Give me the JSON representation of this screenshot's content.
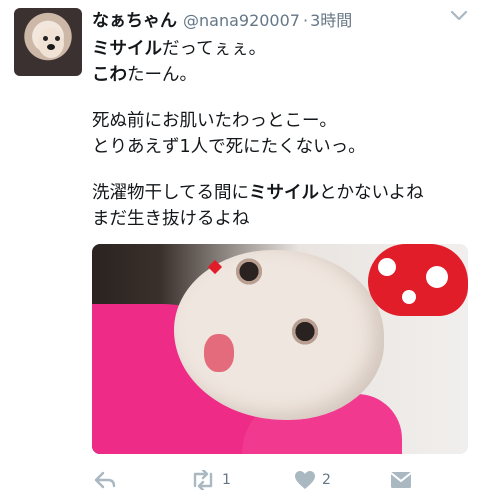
{
  "tweet": {
    "author_name": "なぁちゃん",
    "handle": "@nana920007",
    "separator": "·",
    "time": "3時間",
    "lines": [
      [
        {
          "text": "ミサイル",
          "bold": true
        },
        {
          "text": "だってぇぇ。",
          "bold": false
        }
      ],
      [
        {
          "text": "こわ",
          "bold": true
        },
        {
          "text": "たーん。",
          "bold": false
        }
      ],
      [],
      [
        {
          "text": "死ぬ前にお肌いたわっとこー。",
          "bold": false
        }
      ],
      [
        {
          "text": "とりあえず1人で死にたくないっ。",
          "bold": false
        }
      ],
      [],
      [
        {
          "text": "洗濯物干してる間に",
          "bold": false
        },
        {
          "text": "ミサイル",
          "bold": true
        },
        {
          "text": "とかないよね",
          "bold": false
        }
      ],
      [
        {
          "text": "まだ生き抜けるよね",
          "bold": false
        }
      ]
    ]
  },
  "actions": {
    "reply": {
      "icon": "reply-icon"
    },
    "retweet": {
      "icon": "retweet-icon",
      "count": "1"
    },
    "like": {
      "icon": "heart-icon",
      "count": "2"
    },
    "dm": {
      "icon": "envelope-icon"
    }
  },
  "colors": {
    "muted": "#657786",
    "text": "#14171a",
    "accent_red": "#e11d2a",
    "pink": "#ee2b86"
  }
}
